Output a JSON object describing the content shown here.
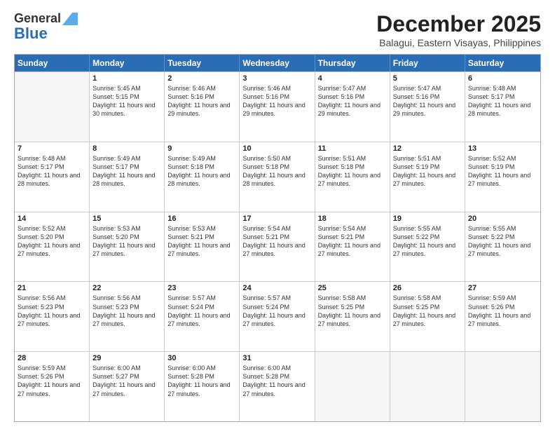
{
  "logo": {
    "general": "General",
    "blue": "Blue"
  },
  "title": "December 2025",
  "location": "Balagui, Eastern Visayas, Philippines",
  "header_days": [
    "Sunday",
    "Monday",
    "Tuesday",
    "Wednesday",
    "Thursday",
    "Friday",
    "Saturday"
  ],
  "weeks": [
    [
      {
        "day": "",
        "sunrise": "",
        "sunset": "",
        "daylight": "",
        "empty": true
      },
      {
        "day": "1",
        "sunrise": "Sunrise: 5:45 AM",
        "sunset": "Sunset: 5:15 PM",
        "daylight": "Daylight: 11 hours and 30 minutes."
      },
      {
        "day": "2",
        "sunrise": "Sunrise: 5:46 AM",
        "sunset": "Sunset: 5:16 PM",
        "daylight": "Daylight: 11 hours and 29 minutes."
      },
      {
        "day": "3",
        "sunrise": "Sunrise: 5:46 AM",
        "sunset": "Sunset: 5:16 PM",
        "daylight": "Daylight: 11 hours and 29 minutes."
      },
      {
        "day": "4",
        "sunrise": "Sunrise: 5:47 AM",
        "sunset": "Sunset: 5:16 PM",
        "daylight": "Daylight: 11 hours and 29 minutes."
      },
      {
        "day": "5",
        "sunrise": "Sunrise: 5:47 AM",
        "sunset": "Sunset: 5:16 PM",
        "daylight": "Daylight: 11 hours and 29 minutes."
      },
      {
        "day": "6",
        "sunrise": "Sunrise: 5:48 AM",
        "sunset": "Sunset: 5:17 PM",
        "daylight": "Daylight: 11 hours and 28 minutes."
      }
    ],
    [
      {
        "day": "7",
        "sunrise": "Sunrise: 5:48 AM",
        "sunset": "Sunset: 5:17 PM",
        "daylight": "Daylight: 11 hours and 28 minutes."
      },
      {
        "day": "8",
        "sunrise": "Sunrise: 5:49 AM",
        "sunset": "Sunset: 5:17 PM",
        "daylight": "Daylight: 11 hours and 28 minutes."
      },
      {
        "day": "9",
        "sunrise": "Sunrise: 5:49 AM",
        "sunset": "Sunset: 5:18 PM",
        "daylight": "Daylight: 11 hours and 28 minutes."
      },
      {
        "day": "10",
        "sunrise": "Sunrise: 5:50 AM",
        "sunset": "Sunset: 5:18 PM",
        "daylight": "Daylight: 11 hours and 28 minutes."
      },
      {
        "day": "11",
        "sunrise": "Sunrise: 5:51 AM",
        "sunset": "Sunset: 5:18 PM",
        "daylight": "Daylight: 11 hours and 27 minutes."
      },
      {
        "day": "12",
        "sunrise": "Sunrise: 5:51 AM",
        "sunset": "Sunset: 5:19 PM",
        "daylight": "Daylight: 11 hours and 27 minutes."
      },
      {
        "day": "13",
        "sunrise": "Sunrise: 5:52 AM",
        "sunset": "Sunset: 5:19 PM",
        "daylight": "Daylight: 11 hours and 27 minutes."
      }
    ],
    [
      {
        "day": "14",
        "sunrise": "Sunrise: 5:52 AM",
        "sunset": "Sunset: 5:20 PM",
        "daylight": "Daylight: 11 hours and 27 minutes."
      },
      {
        "day": "15",
        "sunrise": "Sunrise: 5:53 AM",
        "sunset": "Sunset: 5:20 PM",
        "daylight": "Daylight: 11 hours and 27 minutes."
      },
      {
        "day": "16",
        "sunrise": "Sunrise: 5:53 AM",
        "sunset": "Sunset: 5:21 PM",
        "daylight": "Daylight: 11 hours and 27 minutes."
      },
      {
        "day": "17",
        "sunrise": "Sunrise: 5:54 AM",
        "sunset": "Sunset: 5:21 PM",
        "daylight": "Daylight: 11 hours and 27 minutes."
      },
      {
        "day": "18",
        "sunrise": "Sunrise: 5:54 AM",
        "sunset": "Sunset: 5:21 PM",
        "daylight": "Daylight: 11 hours and 27 minutes."
      },
      {
        "day": "19",
        "sunrise": "Sunrise: 5:55 AM",
        "sunset": "Sunset: 5:22 PM",
        "daylight": "Daylight: 11 hours and 27 minutes."
      },
      {
        "day": "20",
        "sunrise": "Sunrise: 5:55 AM",
        "sunset": "Sunset: 5:22 PM",
        "daylight": "Daylight: 11 hours and 27 minutes."
      }
    ],
    [
      {
        "day": "21",
        "sunrise": "Sunrise: 5:56 AM",
        "sunset": "Sunset: 5:23 PM",
        "daylight": "Daylight: 11 hours and 27 minutes."
      },
      {
        "day": "22",
        "sunrise": "Sunrise: 5:56 AM",
        "sunset": "Sunset: 5:23 PM",
        "daylight": "Daylight: 11 hours and 27 minutes."
      },
      {
        "day": "23",
        "sunrise": "Sunrise: 5:57 AM",
        "sunset": "Sunset: 5:24 PM",
        "daylight": "Daylight: 11 hours and 27 minutes."
      },
      {
        "day": "24",
        "sunrise": "Sunrise: 5:57 AM",
        "sunset": "Sunset: 5:24 PM",
        "daylight": "Daylight: 11 hours and 27 minutes."
      },
      {
        "day": "25",
        "sunrise": "Sunrise: 5:58 AM",
        "sunset": "Sunset: 5:25 PM",
        "daylight": "Daylight: 11 hours and 27 minutes."
      },
      {
        "day": "26",
        "sunrise": "Sunrise: 5:58 AM",
        "sunset": "Sunset: 5:25 PM",
        "daylight": "Daylight: 11 hours and 27 minutes."
      },
      {
        "day": "27",
        "sunrise": "Sunrise: 5:59 AM",
        "sunset": "Sunset: 5:26 PM",
        "daylight": "Daylight: 11 hours and 27 minutes."
      }
    ],
    [
      {
        "day": "28",
        "sunrise": "Sunrise: 5:59 AM",
        "sunset": "Sunset: 5:26 PM",
        "daylight": "Daylight: 11 hours and 27 minutes."
      },
      {
        "day": "29",
        "sunrise": "Sunrise: 6:00 AM",
        "sunset": "Sunset: 5:27 PM",
        "daylight": "Daylight: 11 hours and 27 minutes."
      },
      {
        "day": "30",
        "sunrise": "Sunrise: 6:00 AM",
        "sunset": "Sunset: 5:28 PM",
        "daylight": "Daylight: 11 hours and 27 minutes."
      },
      {
        "day": "31",
        "sunrise": "Sunrise: 6:00 AM",
        "sunset": "Sunset: 5:28 PM",
        "daylight": "Daylight: 11 hours and 27 minutes."
      },
      {
        "day": "",
        "sunrise": "",
        "sunset": "",
        "daylight": "",
        "empty": true
      },
      {
        "day": "",
        "sunrise": "",
        "sunset": "",
        "daylight": "",
        "empty": true
      },
      {
        "day": "",
        "sunrise": "",
        "sunset": "",
        "daylight": "",
        "empty": true
      }
    ]
  ]
}
